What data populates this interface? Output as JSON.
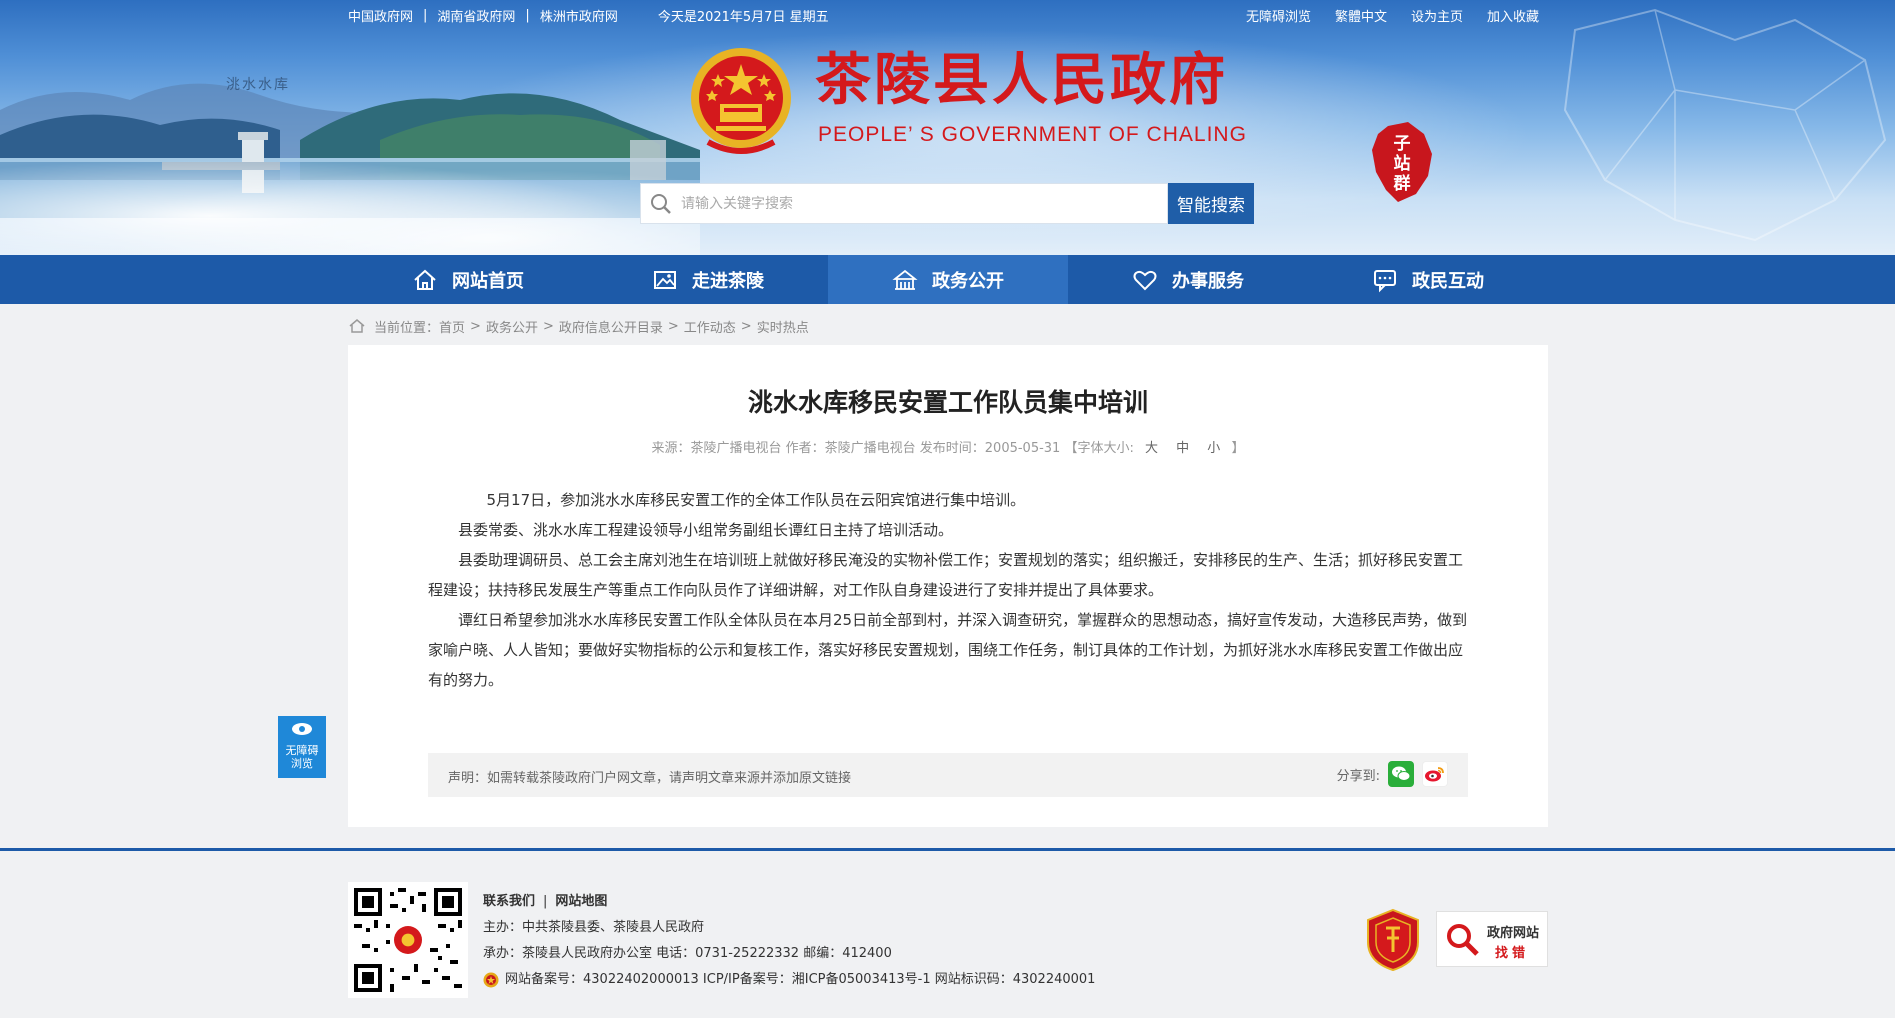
{
  "topbar": {
    "links": [
      "中国政府网",
      "湖南省政府网",
      "株洲市政府网"
    ],
    "separator": "|",
    "today": "今天是2021年5月7日 星期五",
    "right_links": [
      "无障碍浏览",
      "繁體中文",
      "设为主页",
      "加入收藏"
    ]
  },
  "header": {
    "title": "茶陵县人民政府",
    "subtitle": "PEOPLE’ S GOVERNMENT OF CHALING",
    "scene_label": "洮水水库",
    "subsite_label": "子站群"
  },
  "search": {
    "placeholder": "请输入关键字搜索",
    "button_label": "智能搜索"
  },
  "nav": {
    "items": [
      {
        "label": "网站首页",
        "icon": "home-icon"
      },
      {
        "label": "走进茶陵",
        "icon": "picture-icon"
      },
      {
        "label": "政务公开",
        "icon": "building-icon"
      },
      {
        "label": "办事服务",
        "icon": "heart-icon"
      },
      {
        "label": "政民互动",
        "icon": "chat-icon"
      }
    ],
    "active_index": 2
  },
  "breadcrumb": {
    "prefix": "当前位置：",
    "items": [
      "首页",
      "政务公开",
      "政府信息公开目录",
      "工作动态",
      "实时热点"
    ],
    "separator": ">"
  },
  "article": {
    "title": "洮水水库移民安置工作队员集中培训",
    "meta_text": "来源：茶陵广播电视台 作者：茶陵广播电视台 发布时间：2005-05-31 【字体大小:",
    "font_sizes": [
      "大",
      "中",
      "小"
    ],
    "meta_end": "】",
    "paragraphs": [
      "5月17日，参加洮水水库移民安置工作的全体工作队员在云阳宾馆进行集中培训。",
      "县委常委、洮水水库工程建设领导小组常务副组长谭红日主持了培训活动。",
      "县委助理调研员、总工会主席刘池生在培训班上就做好移民淹没的实物补偿工作；安置规划的落实；组织搬迁，安排移民的生产、生活；抓好移民安置工程建设；扶持移民发展生产等重点工作向队员作了详细讲解，对工作队自身建设进行了安排并提出了具体要求。",
      "谭红日希望参加洮水水库移民安置工作队全体队员在本月25日前全部到村，并深入调查研究，掌握群众的思想动态，搞好宣传发动，大造移民声势，做到家喻户晓、人人皆知；要做好实物指标的公示和复核工作，落实好移民安置规划，围绕工作任务，制订具体的工作计划，为抓好洮水水库移民安置工作做出应有的努力。"
    ],
    "statement": "声明：如需转载茶陵政府门户网文章，请声明文章来源并添加原文链接",
    "share_label": "分享到:"
  },
  "accessibility_float": {
    "line1": "无障碍",
    "line2": "浏览"
  },
  "footer": {
    "links": [
      "联系我们",
      "网站地图"
    ],
    "sponsor": "主办：中共茶陵县委、茶陵县人民政府",
    "organizer": "承办：茶陵县人民政府办公室 电话：0731-25222332 邮编：412400",
    "record": "网站备案号：43022402000013 ICP/IP备案号：湘ICP备05003413号-1 网站标识码：4302240001",
    "party_badge_label": "党政机关",
    "findbug_line1": "政府网站",
    "findbug_line2": "找错"
  },
  "colors": {
    "nav_bg": "#1d5aa8",
    "nav_active": "#2f70c0",
    "title_red": "#d4191c",
    "search_button": "#1f5ea8"
  }
}
